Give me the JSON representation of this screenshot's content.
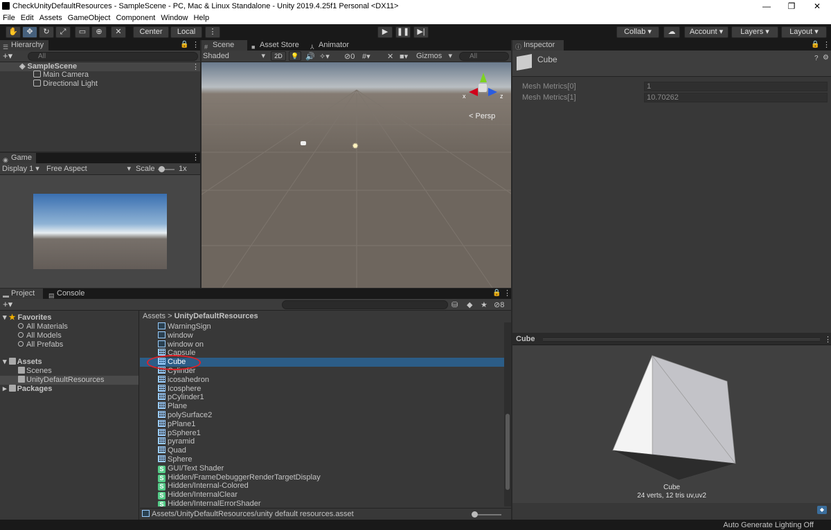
{
  "window": {
    "title": "CheckUnityDefaultResources - SampleScene - PC, Mac & Linux Standalone - Unity 2019.4.25f1 Personal <DX11>",
    "minimize": "—",
    "maximize": "❐",
    "close": "✕"
  },
  "menu": [
    "File",
    "Edit",
    "Assets",
    "GameObject",
    "Component",
    "Window",
    "Help"
  ],
  "toolbar": {
    "pivot": "Center",
    "space": "Local",
    "collab": "Collab",
    "account": "Account",
    "layers": "Layers",
    "layout": "Layout"
  },
  "hierarchy": {
    "tab": "Hierarchy",
    "search_placeholder": "All",
    "scene": "SampleScene",
    "items": [
      "Main Camera",
      "Directional Light"
    ]
  },
  "game": {
    "tab": "Game",
    "display": "Display 1",
    "aspect": "Free Aspect",
    "scale_label": "Scale",
    "scale_value": "1x"
  },
  "scene": {
    "tabs": [
      "Scene",
      "Asset Store",
      "Animator"
    ],
    "shading": "Shaded",
    "mode2d": "2D",
    "hidden_count": "0",
    "gizmos": "Gizmos",
    "search_placeholder": "All",
    "persp": "Persp",
    "axis_x": "x",
    "axis_z": "z",
    "axis_y": "y"
  },
  "inspector": {
    "tab": "Inspector",
    "object": "Cube",
    "fields": [
      {
        "label": "Mesh Metrics[0]",
        "value": "1"
      },
      {
        "label": "Mesh Metrics[1]",
        "value": "10.70262"
      }
    ]
  },
  "preview": {
    "title": "Cube",
    "name": "Cube",
    "stats": "24 verts, 12 tris   uv,uv2"
  },
  "project": {
    "tabs": [
      "Project",
      "Console"
    ],
    "badge": "8",
    "favorites": {
      "label": "Favorites",
      "items": [
        "All Materials",
        "All Models",
        "All Prefabs"
      ]
    },
    "assets": {
      "label": "Assets",
      "items": [
        "Scenes",
        "UnityDefaultResources"
      ]
    },
    "packages": "Packages",
    "breadcrumb": [
      "Assets",
      "UnityDefaultResources"
    ],
    "files": [
      {
        "name": "WarningSign",
        "type": "tex"
      },
      {
        "name": "window",
        "type": "tex"
      },
      {
        "name": "window on",
        "type": "tex"
      },
      {
        "name": "Capsule",
        "type": "mesh"
      },
      {
        "name": "Cube",
        "type": "mesh"
      },
      {
        "name": "Cylinder",
        "type": "mesh"
      },
      {
        "name": "icosahedron",
        "type": "mesh"
      },
      {
        "name": "Icosphere",
        "type": "mesh"
      },
      {
        "name": "pCylinder1",
        "type": "mesh"
      },
      {
        "name": "Plane",
        "type": "mesh"
      },
      {
        "name": "polySurface2",
        "type": "mesh"
      },
      {
        "name": "pPlane1",
        "type": "mesh"
      },
      {
        "name": "pSphere1",
        "type": "mesh"
      },
      {
        "name": "pyramid",
        "type": "mesh"
      },
      {
        "name": "Quad",
        "type": "mesh"
      },
      {
        "name": "Sphere",
        "type": "mesh"
      },
      {
        "name": "GUI/Text Shader",
        "type": "shader"
      },
      {
        "name": "Hidden/FrameDebuggerRenderTargetDisplay",
        "type": "shader"
      },
      {
        "name": "Hidden/Internal-Colored",
        "type": "shader"
      },
      {
        "name": "Hidden/InternalClear",
        "type": "shader"
      },
      {
        "name": "Hidden/InternalErrorShader",
        "type": "shader"
      }
    ],
    "selected_file": "Cube",
    "path": "Assets/UnityDefaultResources/unity default resources.asset"
  },
  "status": {
    "text": "Auto Generate Lighting Off"
  },
  "colors": {
    "selection": "#2c5d87",
    "highlight_circle": "#e0222a"
  }
}
